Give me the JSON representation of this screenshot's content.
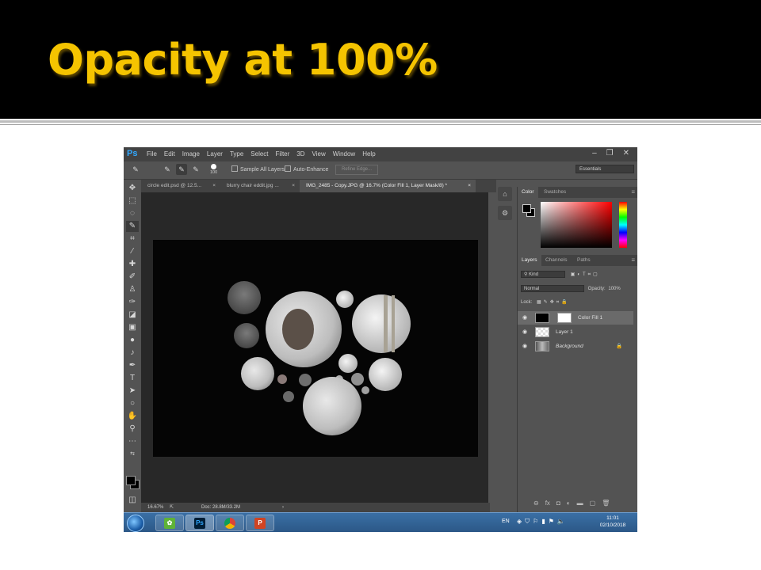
{
  "slide": {
    "title": "Opacity at 100%"
  },
  "menubar": {
    "logo": "Ps",
    "items": [
      "File",
      "Edit",
      "Image",
      "Layer",
      "Type",
      "Select",
      "Filter",
      "3D",
      "View",
      "Window",
      "Help"
    ]
  },
  "options": {
    "brush_size": "100",
    "sample_all_layers": "Sample All Layers",
    "auto_enhance": "Auto-Enhance",
    "refine_edge": "Refine Edge...",
    "workspace": "Essentials"
  },
  "tabs": [
    {
      "label": "circle edit.psd @ 12.5...",
      "close": "×"
    },
    {
      "label": "blurry chair eddit.jpg ...",
      "close": "×"
    },
    {
      "label": "IMG_2485 - Copy.JPG @ 16.7% (Color Fill 1, Layer Mask/8) *",
      "close": "×"
    }
  ],
  "status": {
    "zoom": "16.67%",
    "doc": "Doc: 28.8M/33.2M",
    "arrow": "›"
  },
  "color_panel": {
    "tabs": [
      "Color",
      "Swatches"
    ]
  },
  "layers_panel": {
    "tabs": [
      "Layers",
      "Channels",
      "Paths"
    ],
    "filter": "Kind",
    "blend_mode": "Normal",
    "opacity_label": "Opacity:",
    "opacity_value": "100%",
    "lock_label": "Lock:",
    "layers": [
      {
        "name": "Color Fill 1"
      },
      {
        "name": "Layer 1"
      },
      {
        "name": "Background"
      }
    ]
  },
  "taskbar": {
    "language": "EN",
    "time": "11:01",
    "date": "02/10/2018",
    "apps": [
      "Ps"
    ]
  },
  "colors": {
    "title": "#f5c400",
    "ps_accent": "#31a8ff",
    "canvas": "#050505"
  }
}
